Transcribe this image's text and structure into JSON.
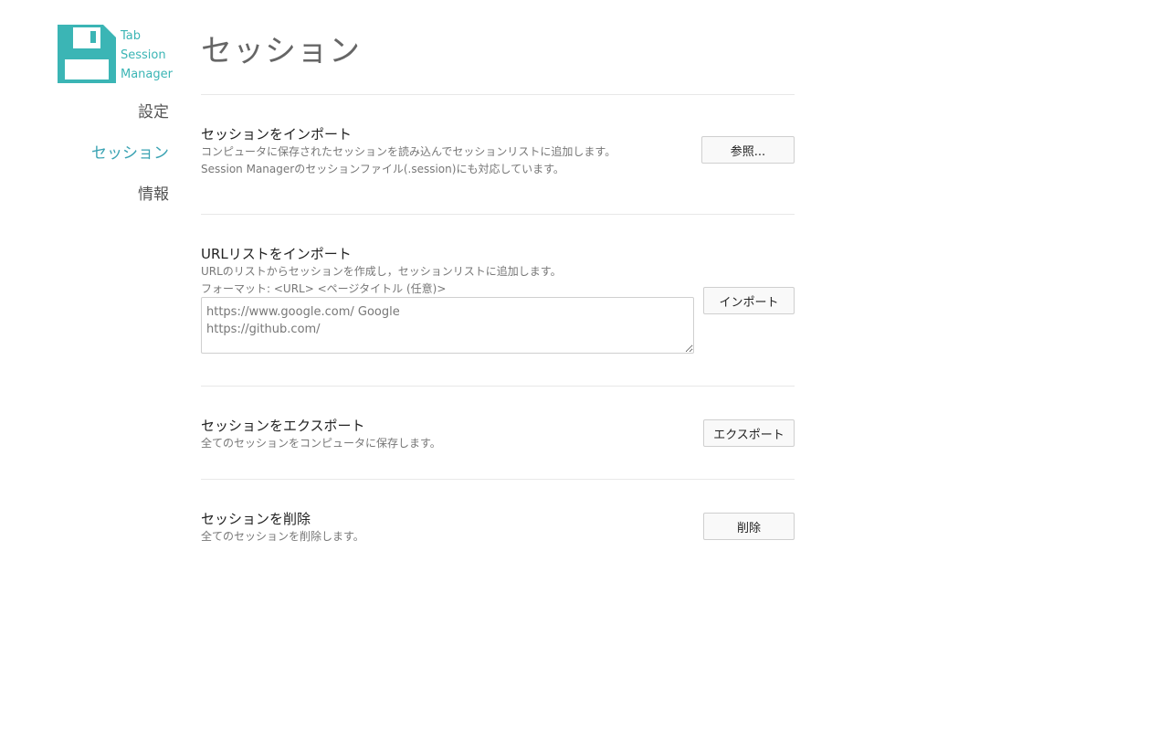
{
  "app": {
    "logo_lines": [
      "Tab",
      "Session",
      "Manager"
    ],
    "logo_icon": "floppy-disk-icon",
    "accent_color": "#3bb5b5"
  },
  "nav": {
    "items": [
      {
        "label": "設定",
        "active": false
      },
      {
        "label": "セッション",
        "active": true
      },
      {
        "label": "情報",
        "active": false
      }
    ]
  },
  "page": {
    "title": "セッション"
  },
  "sections": {
    "import_session": {
      "title": "セッションをインポート",
      "desc_lines": [
        "コンピュータに保存されたセッションを読み込んでセッションリストに追加します。",
        "Session Managerのセッションファイル(.session)にも対応しています。"
      ],
      "button": "参照..."
    },
    "import_urls": {
      "title": "URLリストをインポート",
      "desc_lines": [
        "URLのリストからセッションを作成し，セッションリストに追加します。",
        "フォーマット: <URL> <ページタイトル (任意)>"
      ],
      "textarea_placeholder": "https://www.google.com/ Google\nhttps://github.com/",
      "button": "インポート"
    },
    "export_session": {
      "title": "セッションをエクスポート",
      "desc_lines": [
        "全てのセッションをコンピュータに保存します。"
      ],
      "button": "エクスポート"
    },
    "delete_session": {
      "title": "セッションを削除",
      "desc_lines": [
        "全てのセッションを削除します。"
      ],
      "button": "削除"
    }
  }
}
